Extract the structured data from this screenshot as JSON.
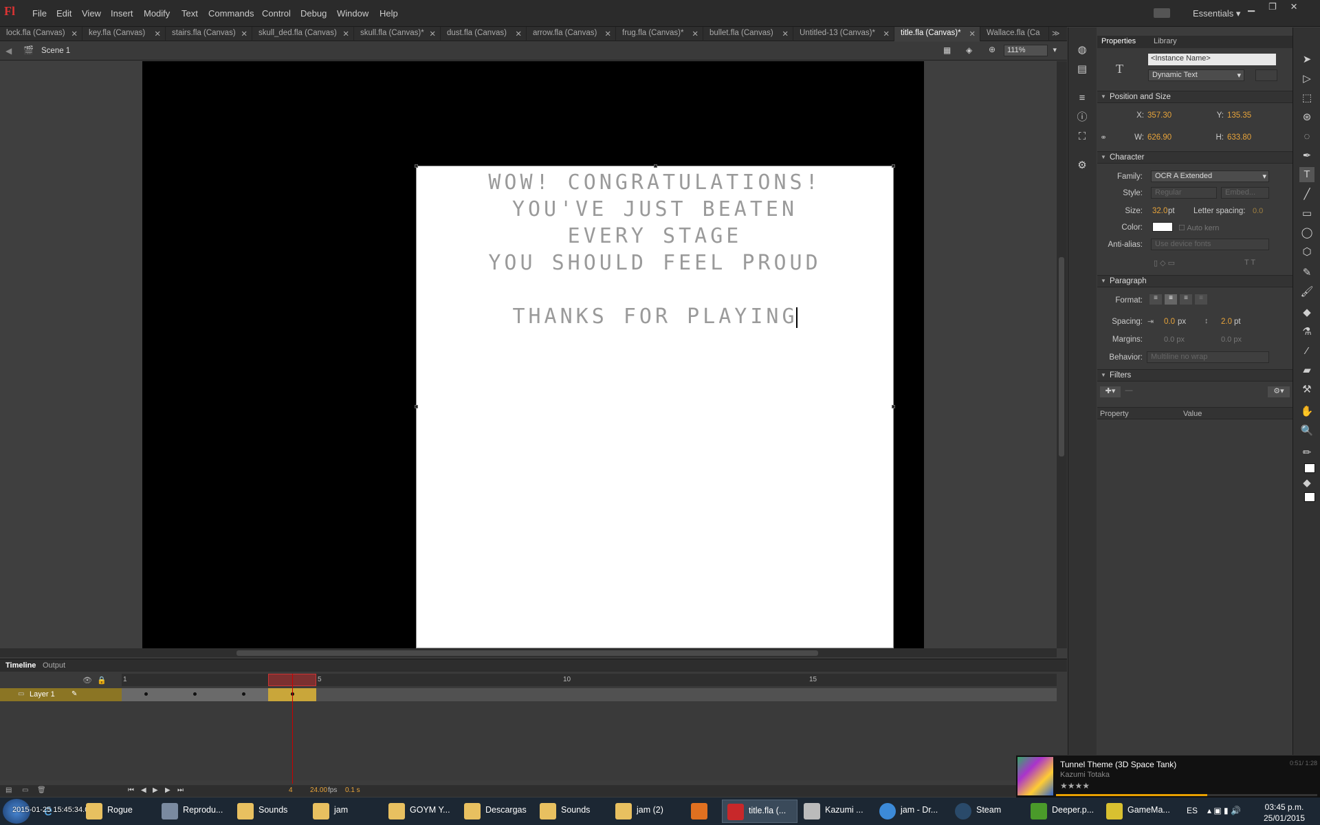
{
  "app": {
    "logo": "Fl",
    "workspace": "Essentials"
  },
  "menu": [
    "File",
    "Edit",
    "View",
    "Insert",
    "Modify",
    "Text",
    "Commands",
    "Control",
    "Debug",
    "Window",
    "Help"
  ],
  "doc_tabs": [
    {
      "label": "lock.fla (Canvas)",
      "active": false
    },
    {
      "label": "key.fla (Canvas)",
      "active": false
    },
    {
      "label": "stairs.fla (Canvas)",
      "active": false
    },
    {
      "label": "skull_ded.fla (Canvas)",
      "active": false
    },
    {
      "label": "skull.fla (Canvas)*",
      "active": false
    },
    {
      "label": "dust.fla (Canvas)",
      "active": false
    },
    {
      "label": "arrow.fla (Canvas)",
      "active": false
    },
    {
      "label": "frug.fla (Canvas)*",
      "active": false
    },
    {
      "label": "bullet.fla (Canvas)",
      "active": false
    },
    {
      "label": "Untitled-13 (Canvas)*",
      "active": false
    },
    {
      "label": "title.fla (Canvas)*",
      "active": true
    },
    {
      "label": "Wallace.fla (Ca",
      "active": false
    }
  ],
  "editbar": {
    "scene": "Scene 1",
    "zoom": "111%"
  },
  "stage": {
    "lines": [
      "WOW! CONGRATULATIONS!",
      "YOU'VE JUST BEATEN",
      "EVERY STAGE",
      "YOU SHOULD FEEL PROUD",
      "",
      "THANKS FOR PLAYING"
    ]
  },
  "properties": {
    "tabs": [
      "Properties",
      "Library"
    ],
    "instance_placeholder": "<Instance Name>",
    "text_type": "Dynamic Text",
    "position_size": {
      "title": "Position and Size",
      "x_label": "X:",
      "x": "357.30",
      "y_label": "Y:",
      "y": "135.35",
      "w_label": "W:",
      "w": "626.90",
      "h_label": "H:",
      "h": "633.80"
    },
    "character": {
      "title": "Character",
      "family_label": "Family:",
      "family": "OCR A Extended",
      "style_label": "Style:",
      "style": "Regular",
      "embed": "Embed...",
      "size_label": "Size:",
      "size": "32.0",
      "size_unit": "pt",
      "letter_spacing_label": "Letter spacing:",
      "letter_spacing": "0.0",
      "color_label": "Color:",
      "auto_kern": "Auto kern",
      "anti_alias_label": "Anti-alias:",
      "anti_alias": "Use device fonts"
    },
    "paragraph": {
      "title": "Paragraph",
      "format_label": "Format:",
      "spacing_label": "Spacing:",
      "indent": "0.0",
      "indent_unit": "px",
      "line_spacing": "2.0",
      "line_unit": "pt",
      "margins_label": "Margins:",
      "margin_left": "0.0 px",
      "margin_right": "0.0 px",
      "behavior_label": "Behavior:",
      "behavior": "Multiline no wrap"
    },
    "filters": {
      "title": "Filters",
      "col_property": "Property",
      "col_value": "Value"
    }
  },
  "timeline": {
    "tabs": [
      "Timeline",
      "Output"
    ],
    "layer": "Layer 1",
    "ruler": [
      "1",
      "5",
      "10",
      "15"
    ],
    "current_frame": "4",
    "fps": "24.00",
    "fps_unit": "fps",
    "time": "0.1 s"
  },
  "now_playing": {
    "title": "Tunnel Theme (3D Space Tank)",
    "artist": "Kazumi Totaka",
    "time": "0:51/ 1:28"
  },
  "taskbar": {
    "items": [
      {
        "label": "Rogue",
        "color": "#e8c060"
      },
      {
        "label": "Reprodu...",
        "color": "#7a8aa0"
      },
      {
        "label": "Sounds",
        "color": "#e8c060"
      },
      {
        "label": "jam",
        "color": "#e8c060"
      },
      {
        "label": "GOYM Y...",
        "color": "#e8c060"
      },
      {
        "label": "Descargas",
        "color": "#e8c060"
      },
      {
        "label": "Sounds",
        "color": "#e8c060"
      },
      {
        "label": "jam (2)",
        "color": "#e8c060"
      },
      {
        "label": "",
        "color": "#e07020"
      },
      {
        "label": "title.fla (...",
        "color": "#c8282a"
      },
      {
        "label": "Kazumi ...",
        "color": "#bbbbbb"
      },
      {
        "label": "jam - Dr...",
        "color": "#3c8ad8"
      },
      {
        "label": "Steam",
        "color": "#2a4a6a"
      },
      {
        "label": "Deeper.p...",
        "color": "#4a9a2a"
      },
      {
        "label": "GameMa...",
        "color": "#d8c030"
      }
    ],
    "overlay_time": "2015-01-25 15:45:34.08",
    "lang": "ES",
    "clock_time": "03:45 p.m.",
    "clock_date": "25/01/2015"
  }
}
